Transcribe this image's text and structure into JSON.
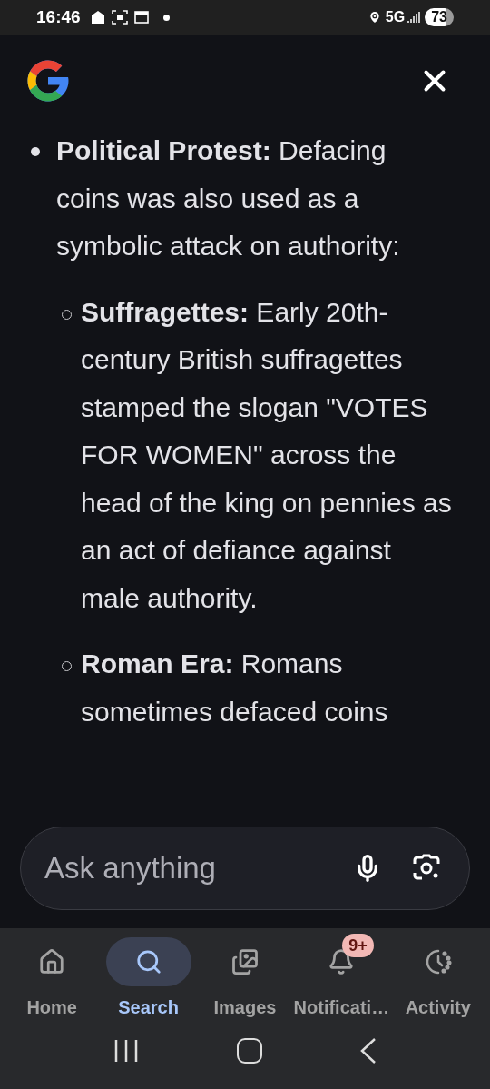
{
  "status_bar": {
    "time": "16:46",
    "network": "5G",
    "battery": "73"
  },
  "content": {
    "items": [
      {
        "text": "**Political Protest:** Defacing coins was also used as a symbolic attack on authority:",
        "children": [
          {
            "text": "**Suffragettes:** Early 20th-century British suffragettes stamped the slogan \"VOTES FOR WOMEN\" across the head of the king on pennies as an act of defiance against male authority."
          },
          {
            "text": "**Roman Era:** Romans sometimes defaced coins"
          }
        ]
      }
    ]
  },
  "ask_field": {
    "placeholder": "Ask anything"
  },
  "bottom_nav": [
    {
      "label": "Home",
      "selected": false
    },
    {
      "label": "Search",
      "selected": true
    },
    {
      "label": "Images",
      "selected": false
    },
    {
      "label": "Notificati…",
      "selected": false,
      "badge": "9+"
    },
    {
      "label": "Activity",
      "selected": false
    }
  ]
}
